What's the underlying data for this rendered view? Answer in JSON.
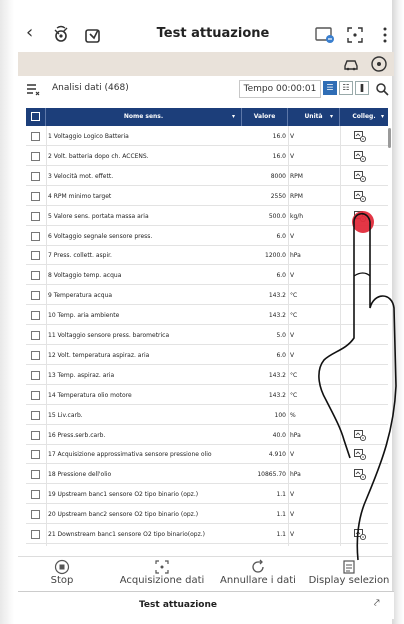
{
  "header": {
    "back_icon": "chevron-left-icon",
    "title": "Test attuazione"
  },
  "toolbar": {
    "analysis_label": "Analisi dati (468)",
    "time_label": "Tempo 00:00:01"
  },
  "table": {
    "columns": [
      "Nome sens.",
      "Valore",
      "Unità",
      "Colleg."
    ],
    "rows": [
      {
        "name": "1 Voltaggio Logico Batteria",
        "value": "16.0",
        "unit": "V",
        "graph": true
      },
      {
        "name": "2 Volt. batteria dopo ch. ACCENS.",
        "value": "16.0",
        "unit": "V",
        "graph": true
      },
      {
        "name": "3 Velocità mot. effett.",
        "value": "8000",
        "unit": "RPM",
        "graph": true
      },
      {
        "name": "4 RPM minimo target",
        "value": "2550",
        "unit": "RPM",
        "graph": true
      },
      {
        "name": "5 Valore sens. portata massa aria",
        "value": "500.0",
        "unit": "kg/h",
        "graph": true
      },
      {
        "name": "6 Voltaggio segnale sensore press.",
        "value": "6.0",
        "unit": "V",
        "graph": false
      },
      {
        "name": "7 Press. collett. aspir.",
        "value": "1200.0",
        "unit": "hPa",
        "graph": false
      },
      {
        "name": "8 Voltaggio temp. acqua",
        "value": "6.0",
        "unit": "V",
        "graph": false
      },
      {
        "name": "9 Temperatura acqua",
        "value": "143.2",
        "unit": "°C",
        "graph": false
      },
      {
        "name": "10 Temp. aria ambiente",
        "value": "143.2",
        "unit": "°C",
        "graph": false
      },
      {
        "name": "11 Voltaggio sensore press. barometrica",
        "value": "5.0",
        "unit": "V",
        "graph": false
      },
      {
        "name": "12 Volt. temperatura aspiraz. aria",
        "value": "6.0",
        "unit": "V",
        "graph": false
      },
      {
        "name": "13 Temp. aspiraz. aria",
        "value": "143.2",
        "unit": "°C",
        "graph": false
      },
      {
        "name": "14 Temperatura olio motore",
        "value": "143.2",
        "unit": "°C",
        "graph": false
      },
      {
        "name": "15 Liv.carb.",
        "value": "100",
        "unit": "%",
        "graph": false
      },
      {
        "name": "16 Press.serb.carb.",
        "value": "40.0",
        "unit": "hPa",
        "graph": true
      },
      {
        "name": "17 Acquisizione approssimativa sensore pressione olio",
        "value": "4.910",
        "unit": "V",
        "graph": true
      },
      {
        "name": "18 Pressione dell'olio",
        "value": "10865.70",
        "unit": "hPa",
        "graph": true
      },
      {
        "name": "19 Upstream banc1 sensore O2 tipo binario (opz.)",
        "value": "1.1",
        "unit": "V",
        "graph": false
      },
      {
        "name": "20 Upstream banc2 sensore O2 tipo binario (opz.)",
        "value": "1.1",
        "unit": "V",
        "graph": false
      },
      {
        "name": "21 Downstream banc1 sensore O2 tipo binario(opz.)",
        "value": "1.1",
        "unit": "V",
        "graph": true
      }
    ]
  },
  "bottom_nav": {
    "stop": "Stop",
    "acquire": "Acquisizione dati",
    "cancel": "Annullare i dati",
    "display": "Display selezion"
  },
  "footer": {
    "title": "Test attuazione"
  },
  "colors": {
    "header_bg": "#1c3e7a",
    "subbar_bg": "#e9e2da",
    "active_view": "#2f6db5",
    "touch_dot": "#e22b3b"
  }
}
